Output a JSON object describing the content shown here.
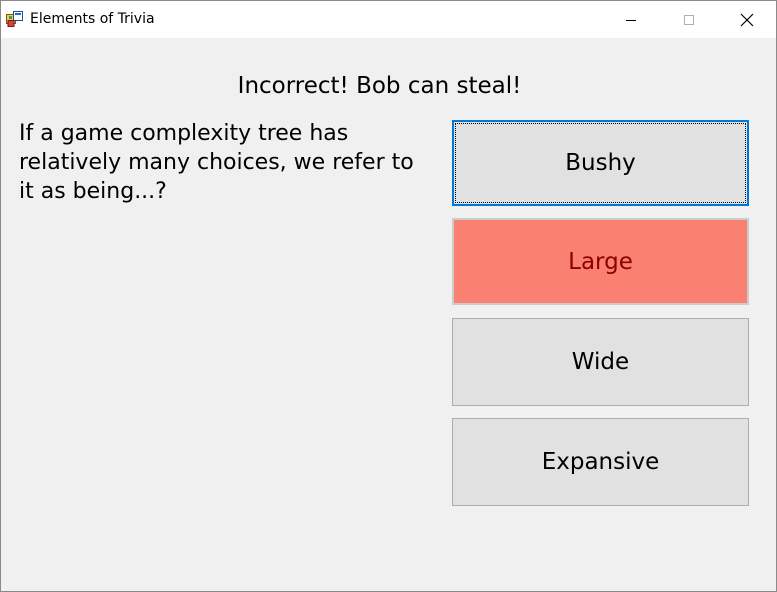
{
  "window": {
    "title": "Elements of Trivia",
    "icon": "app-icon"
  },
  "status": {
    "message": "Incorrect! Bob can steal!"
  },
  "question": {
    "text": "If a game complexity tree has relatively many choices, we refer to it as being...?"
  },
  "answers": [
    {
      "label": "Bushy",
      "state": "focused"
    },
    {
      "label": "Large",
      "state": "incorrect",
      "color": "#fa8072",
      "text_color": "#8b0000"
    },
    {
      "label": "Wide",
      "state": "normal"
    },
    {
      "label": "Expansive",
      "state": "normal"
    }
  ],
  "colors": {
    "background": "#f0f0f0",
    "button": "#e1e1e1",
    "focus": "#0078d7",
    "incorrect": "#fa8072"
  }
}
